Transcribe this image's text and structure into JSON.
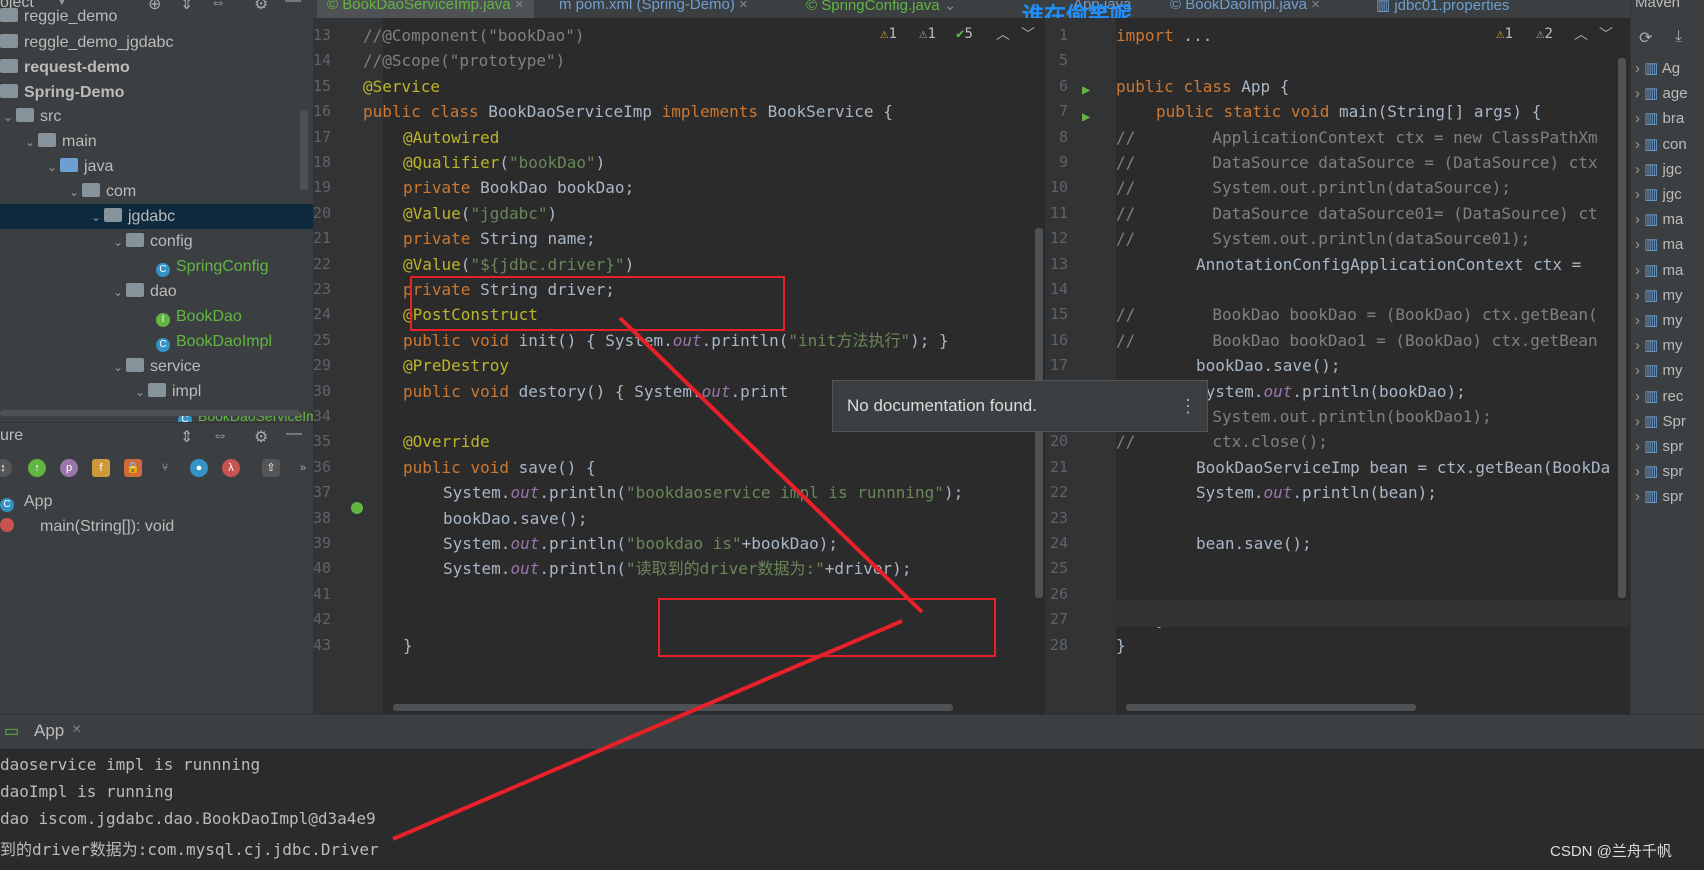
{
  "project": {
    "header": "oject",
    "rows": [
      {
        "label": "reggie_demo"
      },
      {
        "label": "reggle_demo_jgdabc"
      },
      {
        "label": "request-demo"
      },
      {
        "label": "Spring-Demo"
      },
      {
        "label": "src"
      },
      {
        "label": "main"
      },
      {
        "label": "java"
      },
      {
        "label": "com"
      },
      {
        "label": "jgdabc"
      },
      {
        "label": "config"
      },
      {
        "label": "SpringConfig"
      },
      {
        "label": "dao"
      },
      {
        "label": "BookDao"
      },
      {
        "label": "BookDaoImpl"
      },
      {
        "label": "service"
      },
      {
        "label": "impl"
      },
      {
        "label": "BookDaoServiceImp"
      }
    ]
  },
  "structure": {
    "title": "ure",
    "items": [
      {
        "label": "App"
      },
      {
        "label": "main(String[]): void"
      }
    ]
  },
  "tabs": [
    {
      "label": "BookDaoServiceImp.java"
    },
    {
      "label": "pom.xml (Spring-Demo)"
    },
    {
      "label": "SpringConfig.java"
    },
    {
      "label": "App.java"
    },
    {
      "label": "BookDaoImpl.java"
    },
    {
      "label": "jdbc01.properties"
    }
  ],
  "watermark_top": "谁在偷笑呢",
  "watermark_bottom": "CSDN @兰舟千帆",
  "maven": {
    "title": "Maven",
    "rows": [
      "Ag",
      "age",
      "bra",
      "con",
      "jgc",
      "jgc",
      "ma",
      "ma",
      "ma",
      "my",
      "my",
      "my",
      "my",
      "rec",
      "Spr",
      "spr",
      "spr",
      "spr"
    ]
  },
  "left_editor": {
    "inspections": {
      "warn": "1",
      "weak": "1",
      "ok": "5"
    },
    "lines": [
      {
        "n": "13",
        "text": "//@Component(\"bookDao\")"
      },
      {
        "n": "14",
        "text": "//@Scope(\"prototype\")"
      },
      {
        "n": "15",
        "text": "@Service"
      },
      {
        "n": "16",
        "text": "public class BookDaoServiceImp implements BookService {"
      },
      {
        "n": "17",
        "text": "@Autowired"
      },
      {
        "n": "18",
        "text": "@Qualifier(\"bookDao\")"
      },
      {
        "n": "19",
        "text": "private BookDao bookDao;"
      },
      {
        "n": "20",
        "text": "@Value(\"jgdabc\")"
      },
      {
        "n": "21",
        "text": "private String name;"
      },
      {
        "n": "22",
        "text": "@Value(\"${jdbc.driver}\")"
      },
      {
        "n": "23",
        "text": "private String driver;"
      },
      {
        "n": "24",
        "text": "@PostConstruct"
      },
      {
        "n": "25",
        "text": "public void init() { System.out.println(\"init方法执行\"); }"
      },
      {
        "n": "29",
        "text": "@PreDestroy"
      },
      {
        "n": "30",
        "text": "public void destory() { System.out.print"
      },
      {
        "n": "34",
        "text": ""
      },
      {
        "n": "35",
        "text": "@Override"
      },
      {
        "n": "36",
        "text": "public void save() {"
      },
      {
        "n": "37",
        "text": "System.out.println(\"bookdaoservice impl is runnning\");"
      },
      {
        "n": "38",
        "text": "bookDao.save();"
      },
      {
        "n": "39",
        "text": "System.out.println(\"bookdao is\"+bookDao);"
      },
      {
        "n": "40",
        "text": "System.out.println(\"读取到的driver数据为:\"+driver);"
      },
      {
        "n": "41",
        "text": ""
      },
      {
        "n": "42",
        "text": ""
      },
      {
        "n": "43",
        "text": "}"
      }
    ]
  },
  "right_editor": {
    "inspections": {
      "warn": "1",
      "weak": "2"
    },
    "lines": [
      {
        "n": "1",
        "text": "import ..."
      },
      {
        "n": "5",
        "text": ""
      },
      {
        "n": "6",
        "text": "public class App {"
      },
      {
        "n": "7",
        "text": "public static void main(String[] args) {"
      },
      {
        "n": "8",
        "text": "//        ApplicationContext ctx = new ClassPathXm"
      },
      {
        "n": "9",
        "text": "//        DataSource dataSource = (DataSource) ctx"
      },
      {
        "n": "10",
        "text": "//        System.out.println(dataSource);"
      },
      {
        "n": "11",
        "text": "//        DataSource dataSource01= (DataSource) ct"
      },
      {
        "n": "12",
        "text": "//        System.out.println(dataSource01);"
      },
      {
        "n": "13",
        "text": "AnnotationConfigApplicationContext ctx = "
      },
      {
        "n": "14",
        "text": ""
      },
      {
        "n": "15",
        "text": "//        BookDao bookDao = (BookDao) ctx.getBean("
      },
      {
        "n": "16",
        "text": "//        BookDao bookDao1 = (BookDao) ctx.getBean"
      },
      {
        "n": "17",
        "text": "bookDao.save();"
      },
      {
        "n": "18",
        "text": "System.out.println(bookDao);"
      },
      {
        "n": "19",
        "text": "//        System.out.println(bookDao1);"
      },
      {
        "n": "20",
        "text": "//        ctx.close();"
      },
      {
        "n": "21",
        "text": "BookDaoServiceImp bean = ctx.getBean(BookDa"
      },
      {
        "n": "22",
        "text": "System.out.println(bean);"
      },
      {
        "n": "23",
        "text": ""
      },
      {
        "n": "24",
        "text": "bean.save();"
      },
      {
        "n": "25",
        "text": ""
      },
      {
        "n": "26",
        "text": ""
      },
      {
        "n": "27",
        "text": "}"
      },
      {
        "n": "28",
        "text": "}"
      }
    ]
  },
  "popup": "No documentation found.",
  "run": {
    "tab": "App",
    "output": [
      "daoservice impl is runnning",
      "daoImpl is running",
      "dao iscom.jgdabc.dao.BookDaoImpl@d3a4e9",
      "到的driver数据为:com.mysql.cj.jdbc.Driver"
    ]
  }
}
